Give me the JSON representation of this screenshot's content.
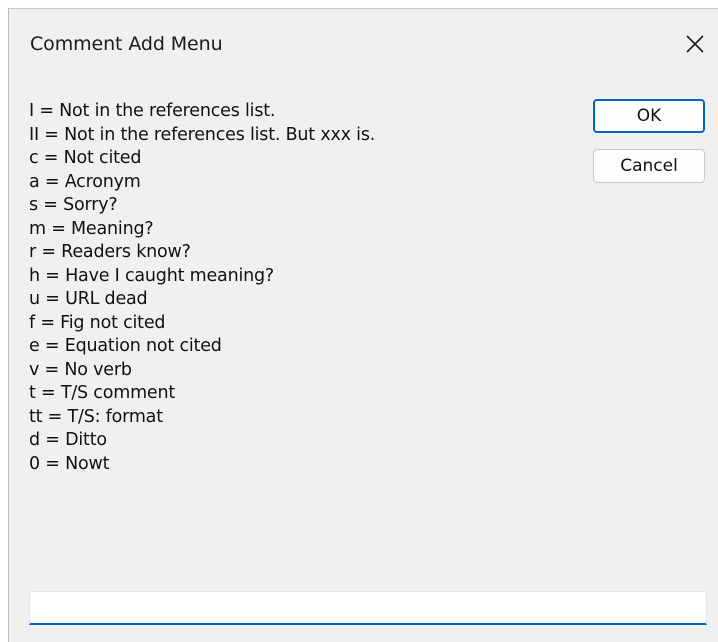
{
  "window": {
    "title": "Comment Add Menu"
  },
  "menu_items": [
    "I = Not in the references list.",
    "II = Not in the references list. But xxx is.",
    "c = Not cited",
    "a = Acronym",
    "s = Sorry?",
    "m = Meaning?",
    "r = Readers know?",
    "h = Have I caught meaning?",
    "u = URL dead",
    "f = Fig not cited",
    "e = Equation not cited",
    "v = No verb",
    "t = T/S comment",
    "tt = T/S: format",
    "d = Ditto",
    "0 = Nowt"
  ],
  "buttons": {
    "ok_label": "OK",
    "cancel_label": "Cancel"
  },
  "input": {
    "value": ""
  },
  "colors": {
    "accent": "#0067c0",
    "dialog_background": "#f0f0f0"
  },
  "icons": {
    "close": "close-icon"
  }
}
